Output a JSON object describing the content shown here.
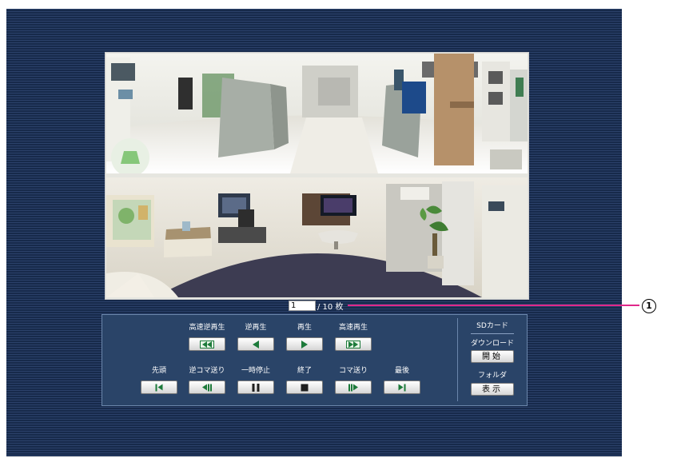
{
  "viewer": {
    "current_page": "1",
    "total_text": "/ 10 枚"
  },
  "callout": {
    "number": "1"
  },
  "playback": {
    "row1": [
      {
        "label": "高速逆再生",
        "icon": "fast-reverse-icon"
      },
      {
        "label": "逆再生",
        "icon": "reverse-play-icon"
      },
      {
        "label": "再生",
        "icon": "play-icon"
      },
      {
        "label": "高速再生",
        "icon": "fast-forward-icon"
      }
    ],
    "row2": [
      {
        "label": "先頭",
        "icon": "skip-to-first-icon"
      },
      {
        "label": "逆コマ送り",
        "icon": "frame-back-icon"
      },
      {
        "label": "一時停止",
        "icon": "pause-icon"
      },
      {
        "label": "終了",
        "icon": "stop-icon"
      },
      {
        "label": "コマ送り",
        "icon": "frame-forward-icon"
      },
      {
        "label": "最後",
        "icon": "skip-to-last-icon"
      }
    ]
  },
  "sd_card": {
    "title": "SDカード",
    "download_label": "ダウンロード",
    "download_button": "開始",
    "folder_label": "フォルダ",
    "folder_button": "表示"
  },
  "colors": {
    "panel_background": "#1e3358",
    "controls_background": "#2a4468",
    "callout_line": "#e0288a",
    "button_icon_green": "#1c7a3a"
  }
}
